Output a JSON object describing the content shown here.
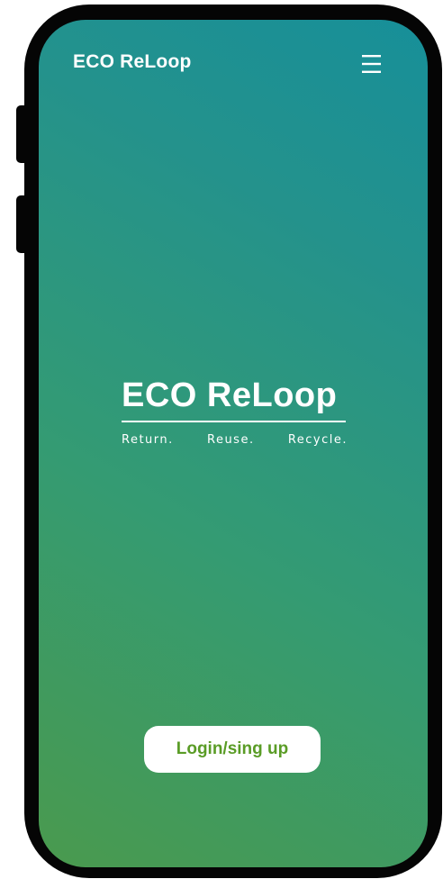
{
  "header": {
    "brand": "ECO ReLoop",
    "menu_icon": "hamburger-menu-icon"
  },
  "hero": {
    "logo_text": "ECO ReLoop",
    "tagline": [
      "Return.",
      "Reuse.",
      "Recycle."
    ]
  },
  "actions": {
    "login_label": "Login/sing up"
  },
  "colors": {
    "gradient_start": "#4a9a4e",
    "gradient_end": "#178f99",
    "button_text": "#5a9c26",
    "device_frame": "#050505"
  }
}
